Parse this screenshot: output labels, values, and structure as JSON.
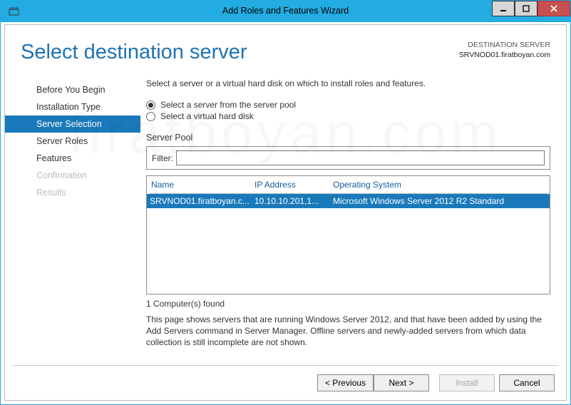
{
  "titlebar": {
    "title": "Add Roles and Features Wizard"
  },
  "header": {
    "pageTitle": "Select destination server",
    "destLabel": "DESTINATION SERVER",
    "destValue": "SRVNOD01.firatboyan.com"
  },
  "sidebar": {
    "steps": {
      "beforeYouBegin": "Before You Begin",
      "installationType": "Installation Type",
      "serverSelection": "Server Selection",
      "serverRoles": "Server Roles",
      "features": "Features",
      "confirmation": "Confirmation",
      "results": "Results"
    }
  },
  "main": {
    "instruction": "Select a server or a virtual hard disk on which to install roles and features.",
    "radioPool": "Select a server from the server pool",
    "radioVhd": "Select a virtual hard disk",
    "serverPoolLabel": "Server Pool",
    "filterLabel": "Filter:",
    "filterValue": "",
    "columns": {
      "name": "Name",
      "ip": "IP Address",
      "os": "Operating System"
    },
    "row": {
      "name": "SRVNOD01.firatboyan.c...",
      "ip": "10.10.10.201,1...",
      "os": "Microsoft Windows Server 2012 R2 Standard"
    },
    "foundText": "1 Computer(s) found",
    "note": "This page shows servers that are running Windows Server 2012, and that have been added by using the Add Servers command in Server Manager. Offline servers and newly-added servers from which data collection is still incomplete are not shown."
  },
  "footer": {
    "previous": "< Previous",
    "next": "Next >",
    "install": "Install",
    "cancel": "Cancel"
  },
  "watermark": "firatboyan.com"
}
